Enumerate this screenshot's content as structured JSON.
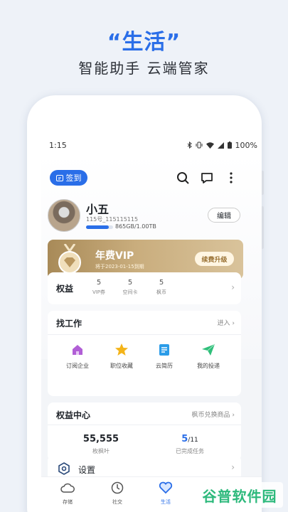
{
  "promo": {
    "title": "“生活”",
    "subtitle": "智能助手 云端管家"
  },
  "status_bar": {
    "time": "1:15",
    "battery": "100%"
  },
  "header": {
    "checkin_label": "签到",
    "icons": [
      "search-icon",
      "message-icon",
      "more-icon"
    ]
  },
  "profile": {
    "name": "小五",
    "user_id": "115号_115115115",
    "storage_text": "865GB/1.00TB",
    "storage_used_fraction": 0.85,
    "edit_label": "编辑"
  },
  "vip": {
    "title": "年费VIP",
    "expire": "将于2023-01-15到期",
    "upgrade_label": "续费升级"
  },
  "rights": {
    "title": "权益",
    "stats": [
      {
        "value": "5",
        "label": "VIP券"
      },
      {
        "value": "5",
        "label": "空间卡"
      },
      {
        "value": "5",
        "label": "枫币"
      }
    ]
  },
  "jobs": {
    "title": "找工作",
    "link": "进入",
    "items": [
      {
        "label": "订阅企业",
        "icon": "home-icon"
      },
      {
        "label": "职位收藏",
        "icon": "star-icon"
      },
      {
        "label": "云简历",
        "icon": "resume-icon"
      },
      {
        "label": "我的投递",
        "icon": "send-icon"
      }
    ]
  },
  "benefit_center": {
    "title": "权益中心",
    "link": "枫币兑换商品",
    "leaves": {
      "value": "55,555",
      "label": "枚枫叶"
    },
    "tasks": {
      "done": "5",
      "total": "/11",
      "label": "已完成任务"
    }
  },
  "settings": {
    "label": "设置"
  },
  "bottom_nav": [
    {
      "label": "存储",
      "icon": "cloud-icon"
    },
    {
      "label": "社交",
      "icon": "clock-icon"
    },
    {
      "label": "生活",
      "icon": "heart-icon"
    }
  ],
  "watermark": "谷普软件园",
  "colors": {
    "accent": "#2a6ee8",
    "vip_gold": "#c9ad7d",
    "watermark_green": "#2db97c"
  }
}
